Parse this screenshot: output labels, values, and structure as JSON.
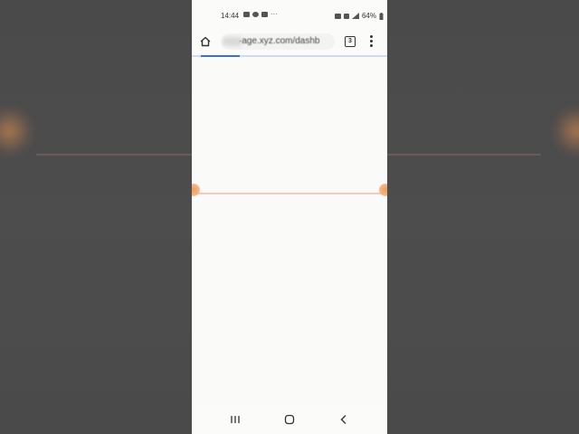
{
  "status_bar": {
    "time": "14:44",
    "battery": "64%"
  },
  "browser": {
    "url": "·age.xyz.com/dashb",
    "tab_count": "3",
    "load_progress": 0.2
  },
  "icons": {
    "home": "home-icon",
    "tabs": "tab-switcher-icon",
    "menu": "more-vert-icon",
    "nav_recent": "recent-apps-icon",
    "nav_home": "home-circle-icon",
    "nav_back": "back-icon"
  },
  "colors": {
    "progress": "#3b6fd1",
    "accent_orange": "#f0a050"
  }
}
